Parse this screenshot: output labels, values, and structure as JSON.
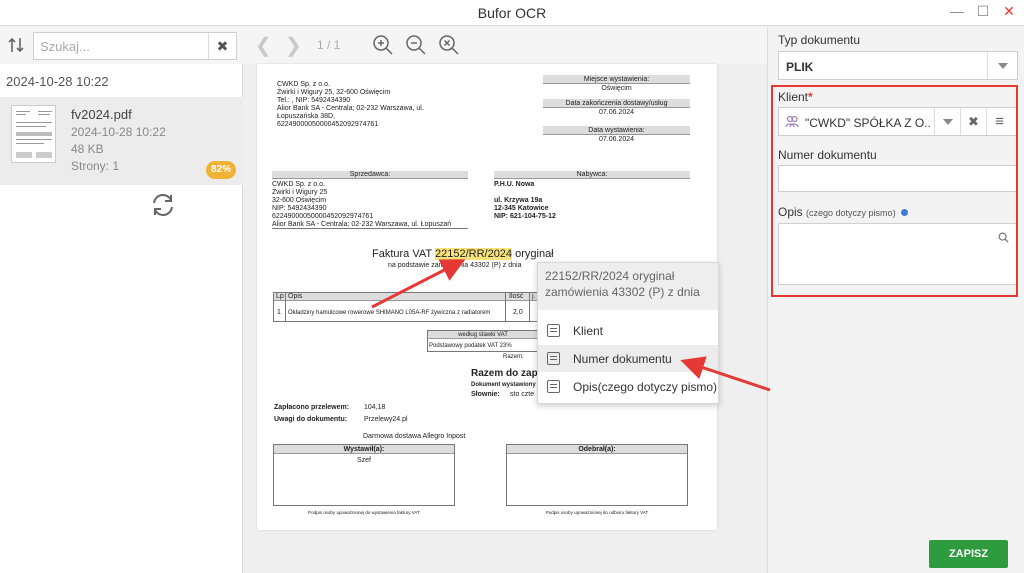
{
  "window": {
    "title": "Bufor OCR",
    "minimize": "—",
    "maximize": "☐",
    "close": "✕"
  },
  "left": {
    "search_placeholder": "Szukaj...",
    "clear_icon": "✖",
    "group_date": "2024-10-28 10:22",
    "file": {
      "name": "fv2024.pdf",
      "date": "2024-10-28 10:22",
      "size": "48 KB",
      "pages": "Strony: 1",
      "confidence": "82%"
    }
  },
  "viewer": {
    "prev": "❮",
    "next": "❯",
    "page_info": "1 / 1",
    "document": {
      "seller_top": [
        "CWKD Sp. z o.o.",
        "Żwirki i Wigury 25, 32-600 Oświęcim",
        "Tel.: , NIP: 5492434390",
        "Alior Bank SA - Centrala; 02-232 Warszawa, ul.",
        "Łopuszańska 38D,",
        "62249000050000452092974761"
      ],
      "place_label": "Miejsce wystawienia:",
      "place_value": "Oświęcim",
      "delivery_label": "Data zakończenia dostawy/usług",
      "delivery_value": "07.06.2024",
      "issue_label": "Data wystawienia:",
      "issue_value": "07.06.2024",
      "seller_header": "Sprzedawca:",
      "seller": [
        "CWKD Sp. z o.o.",
        "Żwirki i Wigury 25",
        "32-600 Oświęcim",
        "NIP: 5492434390",
        "62249000050000452092974761",
        "Alior Bank SA - Centrala; 02-232 Warszawa, ul. Łopuszań"
      ],
      "buyer_header": "Nabywca:",
      "buyer": [
        "P.H.U. Nowa",
        "ul. Krzywa 19a",
        "12-345 Katowice",
        "NIP: 621-104-75-12"
      ],
      "invoice_prefix": "Faktura VAT",
      "invoice_number": "22152/RR/2024",
      "invoice_suffix": "oryginał",
      "order_ref": "na podstawie zamówienia 43302 (P) z dnia",
      "table_lp": "Lp",
      "table_opis": "Opis",
      "table_ilosc": "Ilość",
      "table_j": "j.",
      "row_lp": "1",
      "row_desc": "Okładziny hamulcowe rowerowe SHIMANO L05A-RF żywiczna z radiatorem",
      "row_qty": "2,0",
      "vat_header": "według stawki VAT",
      "vat_row": "Podstawowy podatek VAT 23%",
      "razem_small": "Razem:",
      "razem_big": "Razem do zapł",
      "doc_label": "Dokument wystawiony",
      "slownie": "Słownie:",
      "slownie_val": "sto czte",
      "paid_label": "Zapłacono przelewem:",
      "paid_value": "104,18",
      "notes_label": "Uwagi do dokumentu:",
      "notes_value": "Przelewy24.pl",
      "shipping": "Darmowa dostawa Allegro Inpost",
      "issuer_header": "Wystawił(a):",
      "issuer_value": "Szef",
      "receiver_header": "Odebrał(a):",
      "sig_left": "Podpis osoby upoważnionej do wystawienia faktury VAT",
      "sig_right": "Podpis osoby upoważnionej do odbioru faktury VAT"
    }
  },
  "popup": {
    "preview": "22152/RR/2024 oryginał zamówienia 43302 (P) z dnia",
    "options": [
      "Klient",
      "Numer dokumentu",
      "Opis(czego dotyczy pismo)"
    ]
  },
  "form": {
    "doc_type_label": "Typ dokumentu",
    "doc_type_value": "PLIK",
    "client_label": "Klient",
    "required_mark": "*",
    "client_value": "\"CWKD\" SPÓŁKA Z O...",
    "clear_icon": "✖",
    "menu_icon": "≡",
    "doc_number_label": "Numer dokumentu",
    "doc_number_value": "",
    "desc_label": "Opis",
    "desc_hint": "(czego dotyczy pismo)",
    "desc_value": "",
    "save": "ZAPISZ"
  },
  "colors": {
    "accent_red": "#e53935",
    "save_green": "#2e9c3e",
    "badge": "#f2b233",
    "highlight": "#f9e27a"
  }
}
